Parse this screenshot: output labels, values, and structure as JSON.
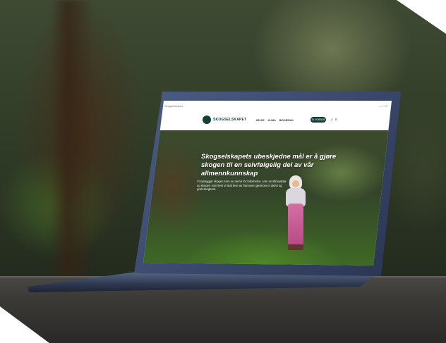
{
  "window": {
    "title": "Skogselskapet"
  },
  "site": {
    "logo_text": "SKOGSELSKAPET",
    "nav_items": [
      "HELSE",
      "KLIMA",
      "BIOGIERAN"
    ],
    "cta_label": "TIL FORSIDE",
    "search_icon": "search-icon",
    "menu_icon": "menu-icon"
  },
  "hero": {
    "title": "Skogselskapets ubeskjedne mål er å gjøre skogen til en selvfølgelig del av vår allmennkunnskap",
    "body": "Vi synliggjør skogen som en arena for folkehelse, som en klimaaktør og skogen som livet vi skal leve av framover gjennom et aktivt og godt skogbruk."
  },
  "colors": {
    "brand": "#14403a",
    "laptop": "#3a4a70"
  }
}
